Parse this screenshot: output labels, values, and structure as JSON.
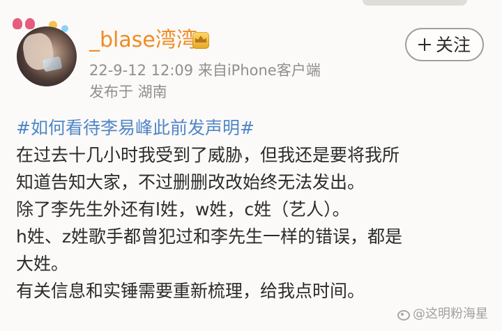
{
  "profile": {
    "username": "_blase湾湾",
    "vip_icon": "crown-icon",
    "avatar": "avatar-image"
  },
  "meta": {
    "timestamp": "22-9-12 12:09  来自iPhone客户端",
    "location": "发布于 湖南"
  },
  "actions": {
    "follow_label": "关注",
    "follow_icon": "plus-icon"
  },
  "post": {
    "hashtag": "#如何看待李易峰此前发声明#",
    "lines": [
      "在过去十几小时我受到了威胁，但我还是要将我所",
      "知道告知大家，不过删删改改始终无法发出。",
      "除了李先生外还有l姓，w姓，c姓（艺人）。",
      "h姓、z姓歌手都曾犯过和李先生一样的错误，都是",
      "大姓。",
      "有关信息和实锤需要重新梳理，给我点时间。"
    ]
  },
  "watermark": {
    "text": "@这明粉海星",
    "icon": "weibo-icon"
  },
  "colors": {
    "username": "#f08a22",
    "hashtag": "#4f86c7",
    "meta": "#8f8f8f",
    "background": "#fbfaf8"
  }
}
